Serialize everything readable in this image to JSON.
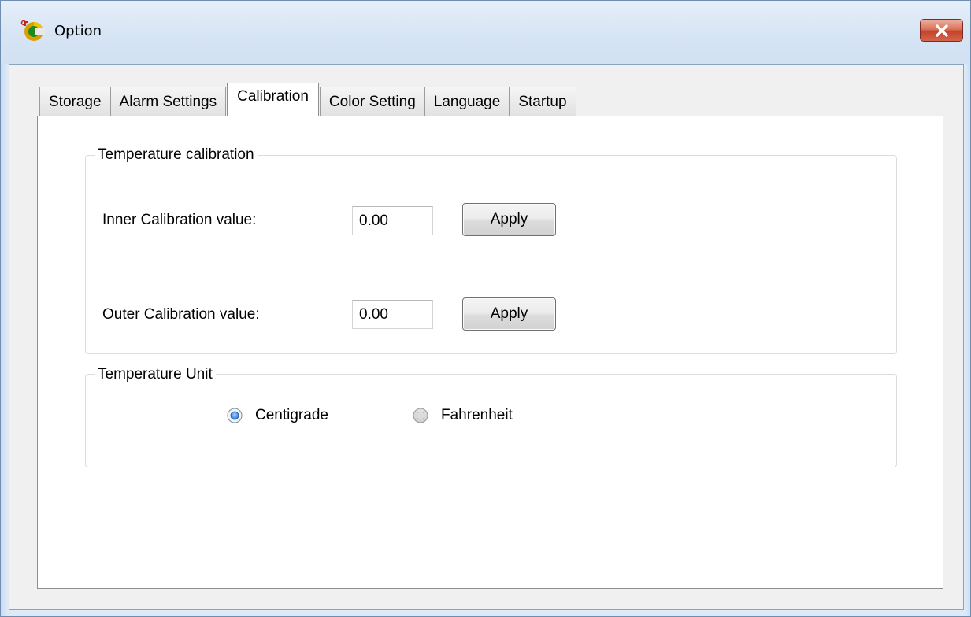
{
  "window": {
    "title": "Option",
    "app_icon": "thermometer-c-icon",
    "close_icon": "close-icon"
  },
  "tabs": [
    {
      "label": "Storage",
      "active": false
    },
    {
      "label": "Alarm Settings",
      "active": false
    },
    {
      "label": "Calibration",
      "active": true
    },
    {
      "label": "Color Setting",
      "active": false
    },
    {
      "label": "Language",
      "active": false
    },
    {
      "label": "Startup",
      "active": false
    }
  ],
  "calibration_group": {
    "title": "Temperature calibration",
    "inner": {
      "label": "Inner Calibration value:",
      "value": "0.00",
      "button": "Apply"
    },
    "outer": {
      "label": "Outer Calibration value:",
      "value": "0.00",
      "button": "Apply"
    }
  },
  "unit_group": {
    "title": "Temperature Unit",
    "options": [
      {
        "label": "Centigrade",
        "selected": true
      },
      {
        "label": "Fahrenheit",
        "selected": false
      }
    ]
  },
  "colors": {
    "close_button": "#c4432a",
    "radio_selected": "#2a6fc9"
  }
}
